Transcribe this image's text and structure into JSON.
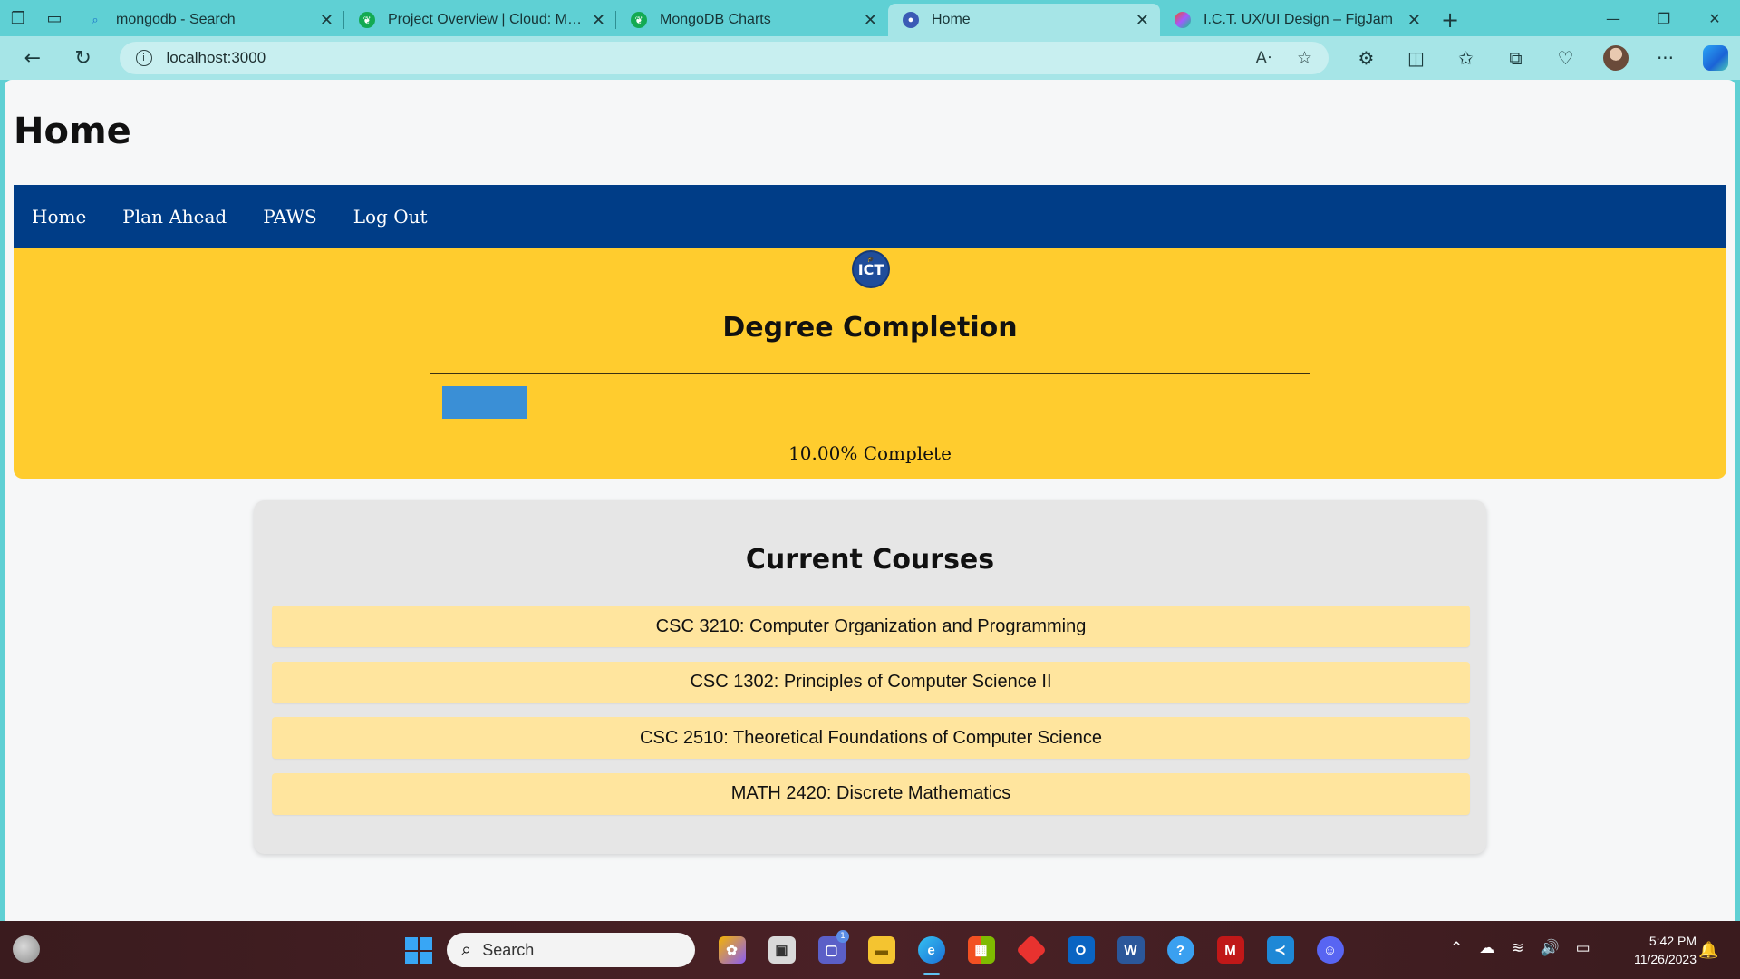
{
  "browser": {
    "tabs": [
      {
        "title": "mongodb - Search",
        "favicon_color": "#1a73c9",
        "active": false
      },
      {
        "title": "Project Overview | Cloud: MongoDB",
        "favicon_color": "#13aa52",
        "active": false
      },
      {
        "title": "MongoDB Charts",
        "favicon_color": "#13aa52",
        "active": false
      },
      {
        "title": "Home",
        "favicon_color": "#3b5bb5",
        "active": true
      },
      {
        "title": "I.C.T. UX/UI Design – FigJam",
        "favicon_color": "#f24e1e",
        "active": false
      }
    ],
    "address": "localhost:3000"
  },
  "page": {
    "title": "Home",
    "nav": [
      "Home",
      "Plan Ahead",
      "PAWS",
      "Log Out"
    ],
    "logo_text": "ICT",
    "degree": {
      "heading": "Degree Completion",
      "progress_percent": 10,
      "progress_label": "10.00% Complete",
      "bar_color": "#3a8fd6",
      "panel_color": "#ffcc2e"
    },
    "courses": {
      "heading": "Current Courses",
      "items": [
        "CSC 3210: Computer Organization and Programming",
        "CSC 1302: Principles of Computer Science II",
        "CSC 2510: Theoretical Foundations of Computer Science",
        "MATH 2420: Discrete Mathematics"
      ]
    },
    "nav_color": "#003d87"
  },
  "taskbar": {
    "search_placeholder": "Search",
    "time": "5:42 PM",
    "date": "11/26/2023",
    "teams_badge": "1"
  }
}
